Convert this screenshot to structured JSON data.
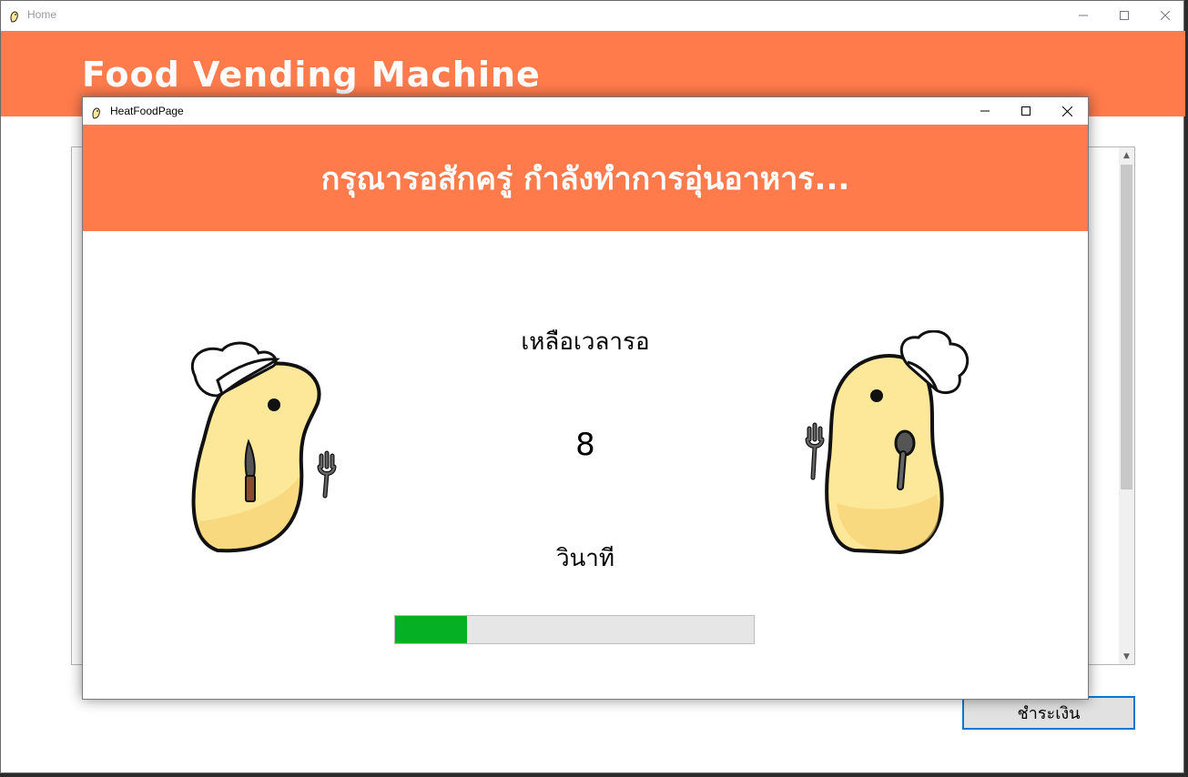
{
  "home": {
    "title": "Home",
    "brand": "Food Vending Machine",
    "pay_button": "ชำระเงิน"
  },
  "dialog": {
    "title": "HeatFoodPage",
    "banner": "กรุณารอสักครู่ กำลังทำการอุ่นอาหาร...",
    "remaining_label": "เหลือเวลารอ",
    "countdown": "8",
    "unit_label": "วินาที",
    "progress_fraction": 0.2
  },
  "colors": {
    "accent": "#ff7b4c",
    "progress_fill": "#06b025",
    "mascot_body": "#fde89a"
  },
  "icons": {
    "app_icon": "chick-icon",
    "minimize": "minimize-icon",
    "maximize": "maximize-icon",
    "close": "close-icon"
  }
}
